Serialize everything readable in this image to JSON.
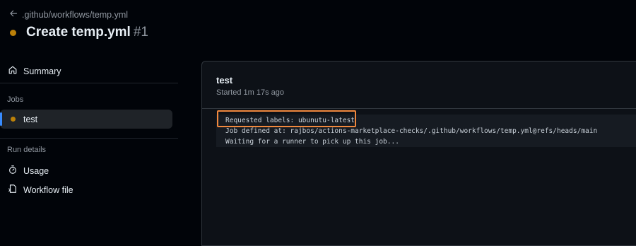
{
  "header": {
    "back_path": ".github/workflows/temp.yml",
    "title": "Create temp.yml",
    "run_number": "#1",
    "status_color": "#bb8009"
  },
  "sidebar": {
    "summary_label": "Summary",
    "jobs_heading": "Jobs",
    "jobs": [
      {
        "label": "test",
        "status": "queued",
        "active": true
      }
    ],
    "run_details_heading": "Run details",
    "run_details": [
      {
        "label": "Usage",
        "icon": "stopwatch-icon"
      },
      {
        "label": "Workflow file",
        "icon": "file-code-icon"
      }
    ]
  },
  "job": {
    "name": "test",
    "started": "Started 1m 17s ago",
    "log_lines": [
      "Requested labels: ubunutu-latest",
      "Job defined at: rajbos/actions-marketplace-checks/.github/workflows/temp.yml@refs/heads/main",
      "Waiting for a runner to pick up this job..."
    ]
  },
  "colors": {
    "background": "#010409",
    "panel": "#0d1117",
    "highlight": "#f0883e",
    "accent": "#388bfd"
  }
}
